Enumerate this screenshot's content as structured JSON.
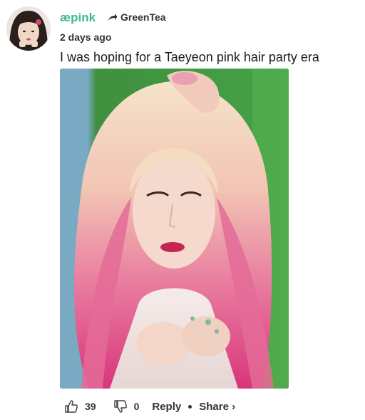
{
  "comment": {
    "username": "æpink",
    "reply_to": "GreenTea",
    "timestamp": "2 days ago",
    "text": "I was hoping for a Taeyeon pink hair party era"
  },
  "actions": {
    "upvote_count": "39",
    "downvote_count": "0",
    "reply_label": "Reply",
    "share_label": "Share ›"
  },
  "icons": {
    "upvote": "thumbs-up-icon",
    "downvote": "thumbs-down-icon",
    "reply_arrow": "arrow-right-icon"
  },
  "colors": {
    "username": "#3dbb8c",
    "text": "#1c1c1c",
    "meta": "#333333"
  }
}
